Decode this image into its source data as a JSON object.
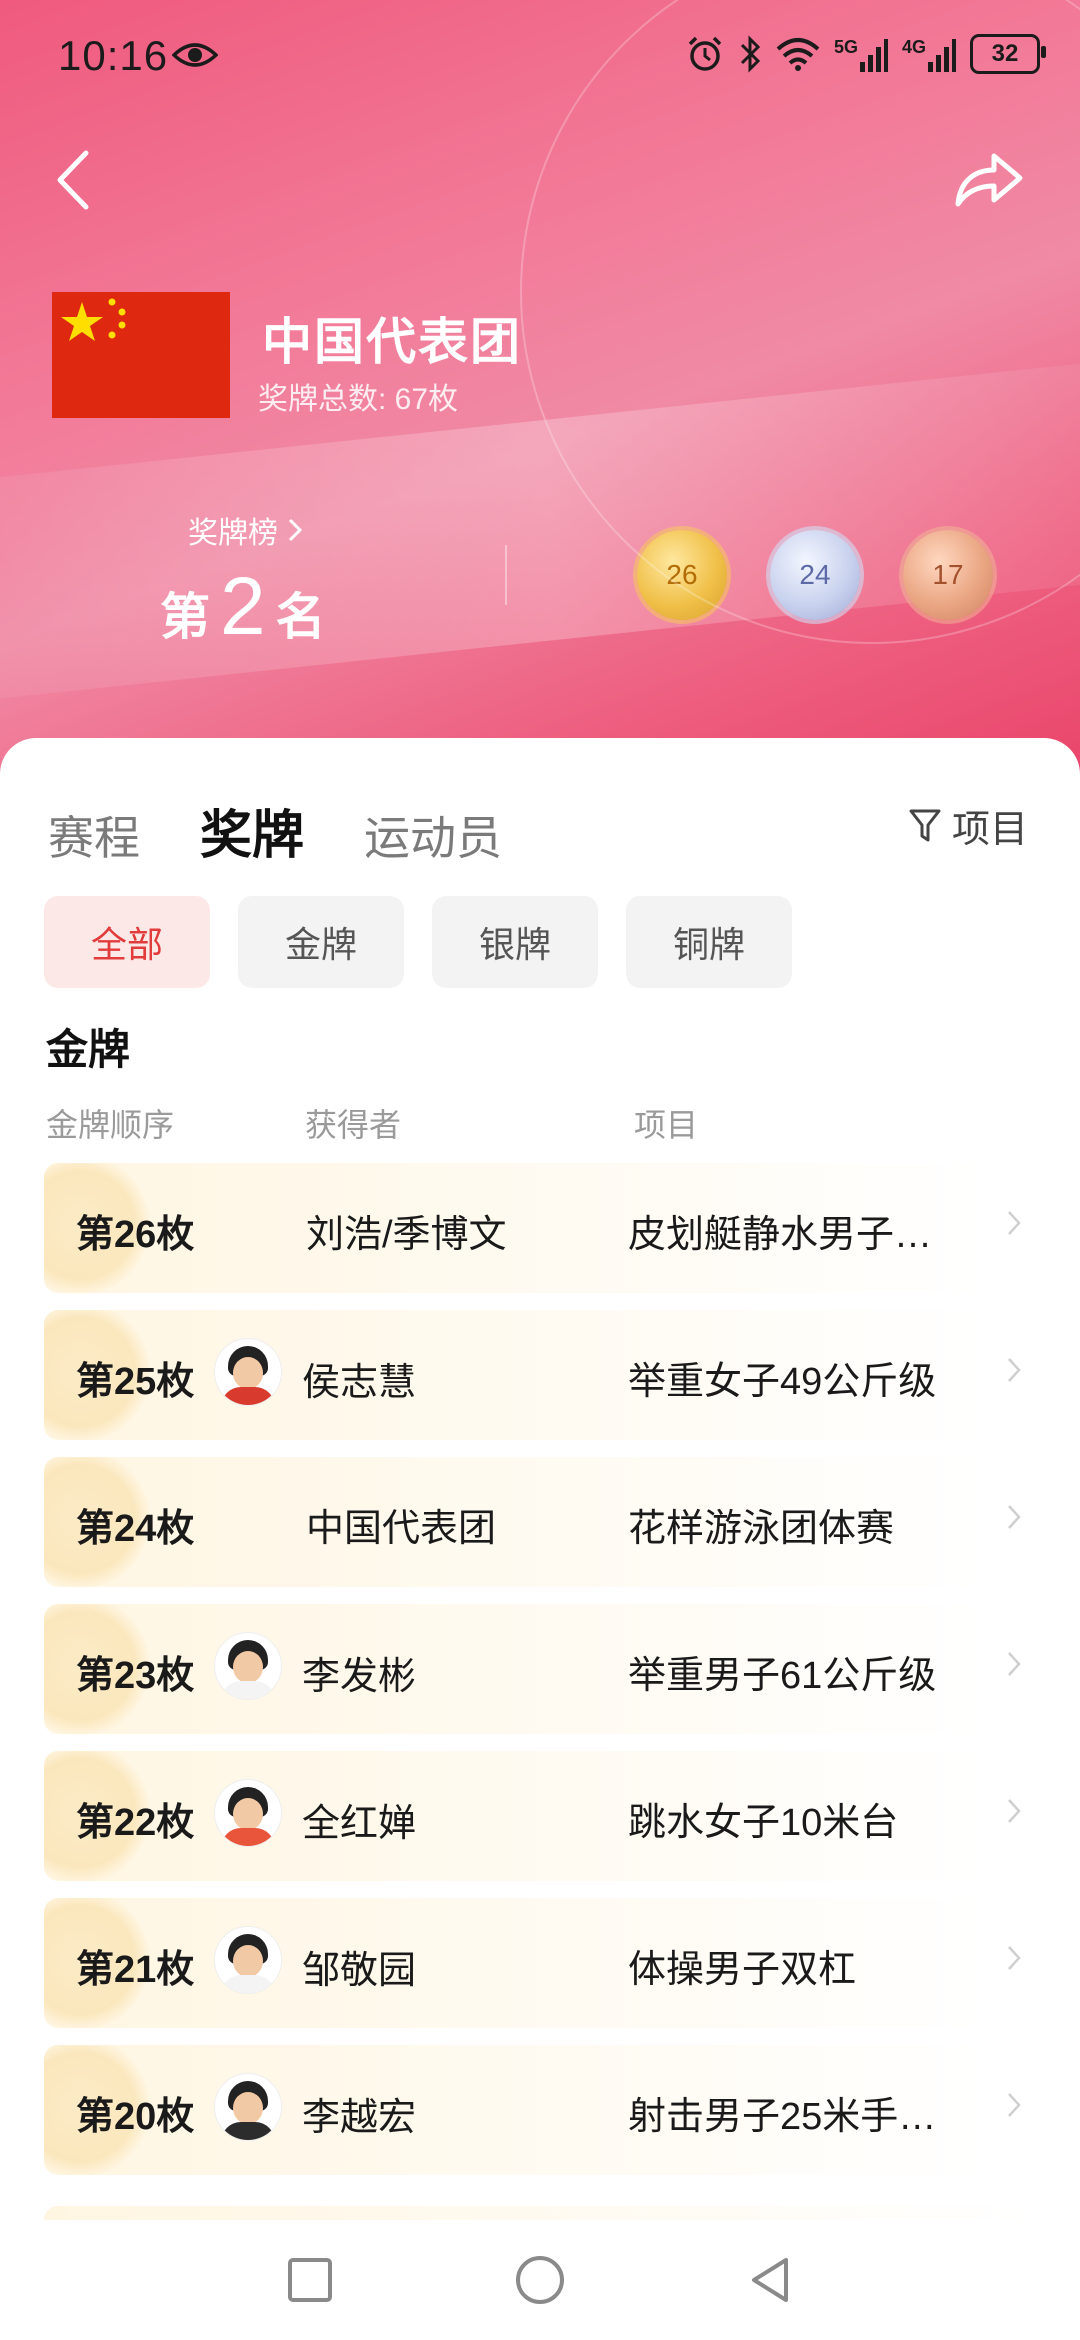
{
  "status_bar": {
    "time": "10:16",
    "net_5g": "5G",
    "net_4g": "4G",
    "battery": "32"
  },
  "header": {
    "team_name": "中国代表团",
    "total_medals": "奖牌总数: 67枚",
    "rank_link_label": "奖牌榜",
    "rank_prefix": "第",
    "rank_number": "2",
    "rank_suffix": "名",
    "medals": {
      "gold": "26",
      "silver": "24",
      "bronze": "17"
    },
    "colors": {
      "gold": "#f0c049",
      "silver": "#c9d2ee",
      "bronze": "#eaa683",
      "flag_red": "#de2910",
      "flag_star": "#ffde00"
    }
  },
  "tabs": [
    {
      "label": "赛程"
    },
    {
      "label": "奖牌"
    },
    {
      "label": "运动员"
    }
  ],
  "filter_label": "项目",
  "chips": [
    {
      "label": "全部"
    },
    {
      "label": "金牌"
    },
    {
      "label": "银牌"
    },
    {
      "label": "铜牌"
    }
  ],
  "section_title": "金牌",
  "columns": {
    "order": "金牌顺序",
    "winner": "获得者",
    "event": "项目"
  },
  "rows": [
    {
      "order": "第26枚",
      "winner": "刘浩/季博文",
      "event": "皮划艇静水男子…",
      "avatar": false
    },
    {
      "order": "第25枚",
      "winner": "侯志慧",
      "event": "举重女子49公斤级",
      "avatar": true
    },
    {
      "order": "第24枚",
      "winner": "中国代表团",
      "event": "花样游泳团体赛",
      "avatar": false
    },
    {
      "order": "第23枚",
      "winner": "李发彬",
      "event": "举重男子61公斤级",
      "avatar": true
    },
    {
      "order": "第22枚",
      "winner": "全红婵",
      "event": "跳水女子10米台",
      "avatar": true
    },
    {
      "order": "第21枚",
      "winner": "邹敬园",
      "event": "体操男子双杠",
      "avatar": true
    },
    {
      "order": "第20枚",
      "winner": "李越宏",
      "event": "射击男子25米手…",
      "avatar": true
    }
  ],
  "icons": {
    "back": "chevron-left-icon",
    "share": "share-icon",
    "filter": "funnel-icon",
    "row_chevron": "chevron-right-icon",
    "nav": [
      "square-icon",
      "circle-icon",
      "triangle-back-icon"
    ]
  }
}
